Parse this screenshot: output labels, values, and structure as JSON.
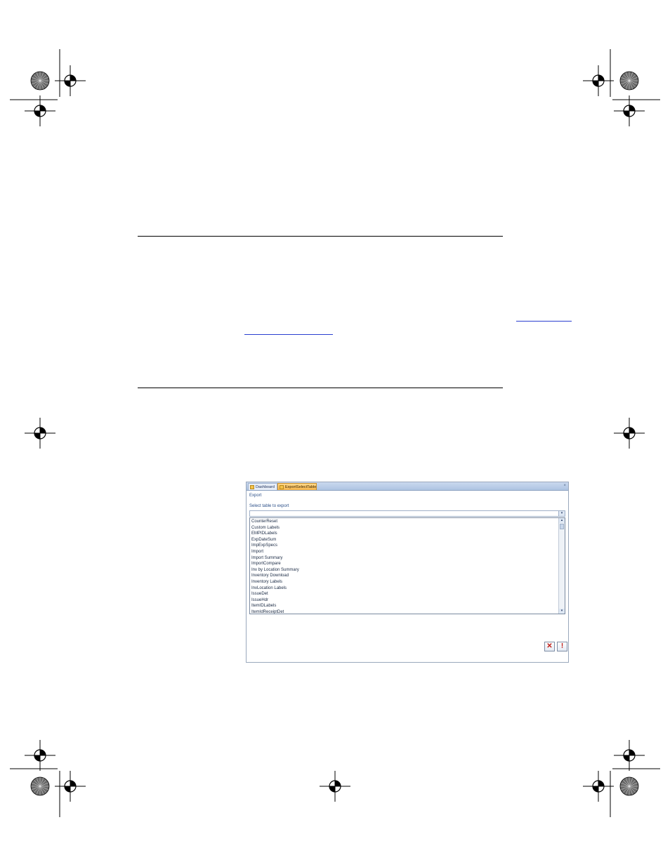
{
  "dialog": {
    "tabs": [
      {
        "label": "Dashboard"
      },
      {
        "label": "ExportSelectTable"
      }
    ],
    "close_glyph": "×",
    "title": "Export",
    "select_label": "Select table to export",
    "combo_value": "",
    "dropdown_glyph": "▾",
    "list_items": [
      "CounterReset",
      "Custom Labels",
      "EMPIDLabels",
      "ExpDateSum",
      "ImpExpSpecs",
      "Import",
      "Import Summary",
      "ImportCompare",
      "Inv by Location Summary",
      "Inventory Download",
      "Inventory Labels",
      "InvLocation Labels",
      "IssueDet",
      "IssueHdr",
      "ItemIDLabels",
      "ItemIdReceiptDet"
    ],
    "scroll_up_glyph": "▴",
    "scroll_down_glyph": "▾",
    "cancel_icon": "✕",
    "run_icon": "!"
  }
}
